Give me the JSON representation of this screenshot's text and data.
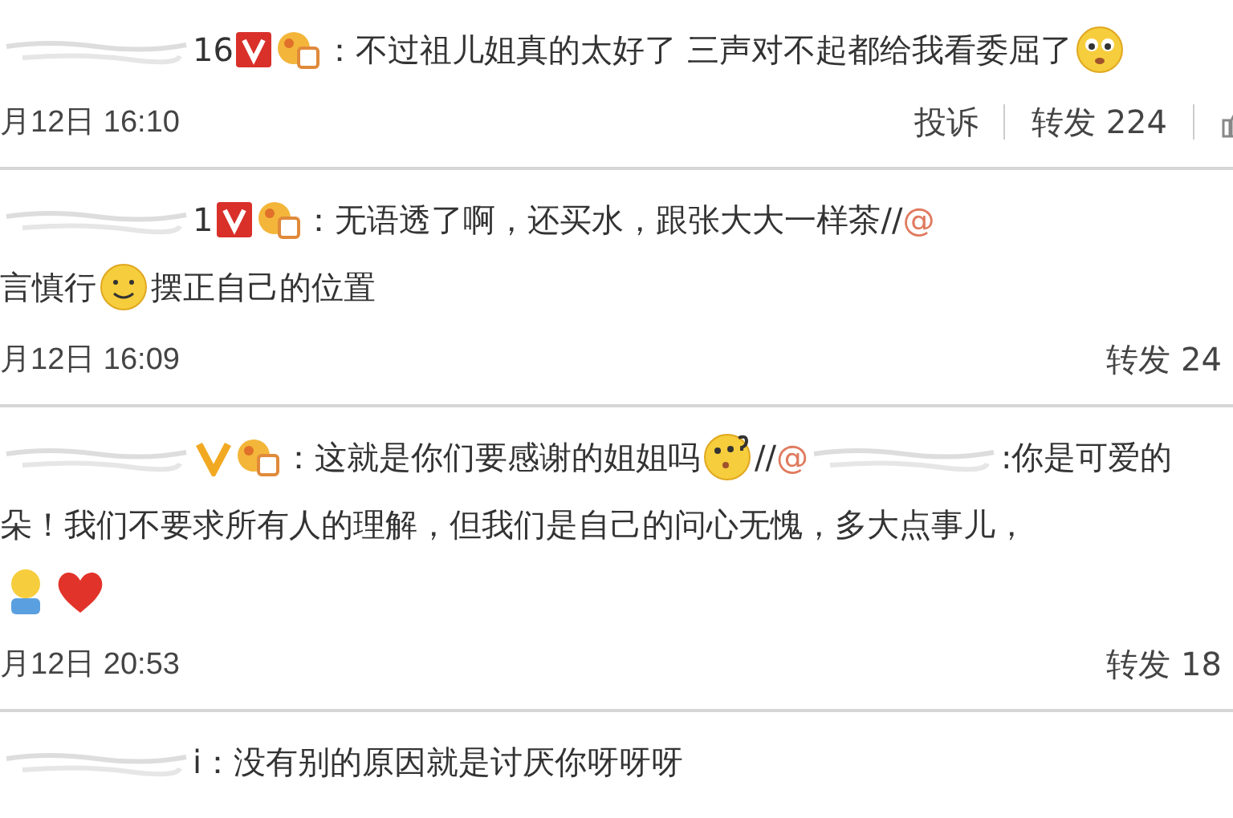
{
  "comments": [
    {
      "header": [
        {
          "kind": "redacted"
        },
        {
          "kind": "text",
          "text": "16"
        },
        {
          "kind": "vip"
        },
        {
          "kind": "member"
        },
        {
          "kind": "text",
          "text": "：不过祖儿姐真的太好了 三声对不起都给我看委屈了"
        },
        {
          "kind": "cry"
        }
      ],
      "date": "月12日 16:10",
      "actions": [
        {
          "kind": "link",
          "label": "投诉"
        },
        {
          "kind": "link",
          "label": "转发 224"
        },
        {
          "kind": "like"
        }
      ]
    },
    {
      "header": [
        {
          "kind": "redacted"
        },
        {
          "kind": "text",
          "text": "1"
        },
        {
          "kind": "vip"
        },
        {
          "kind": "member"
        },
        {
          "kind": "text",
          "text": "：无语透了啊，还买水，跟张大大一样茶//"
        },
        {
          "kind": "mention",
          "text": "@"
        }
      ],
      "lines": [
        [
          {
            "kind": "text",
            "text": "言慎行"
          },
          {
            "kind": "smile"
          },
          {
            "kind": "text",
            "text": "摆正自己的位置"
          }
        ]
      ],
      "date": "月12日 16:09",
      "actions": [
        {
          "kind": "link",
          "label": "转发 24"
        }
      ]
    },
    {
      "header": [
        {
          "kind": "redacted"
        },
        {
          "kind": "verified"
        },
        {
          "kind": "member"
        },
        {
          "kind": "text",
          "text": "：这就是你们要感谢的姐姐吗"
        },
        {
          "kind": "puzzled"
        },
        {
          "kind": "text",
          "text": "//"
        },
        {
          "kind": "mention",
          "text": "@"
        },
        {
          "kind": "redacted"
        },
        {
          "kind": "text",
          "text": ":你是可爱的"
        }
      ],
      "lines": [
        [
          {
            "kind": "text",
            "text": "朵！我们不要求所有人的理解，但我们是自己的问心无愧，多大点事儿，"
          }
        ],
        [
          {
            "kind": "figure"
          },
          {
            "kind": "heart"
          }
        ]
      ],
      "date": "月12日 20:53",
      "actions": [
        {
          "kind": "link",
          "label": "转发 18"
        }
      ]
    },
    {
      "header": [
        {
          "kind": "redacted"
        },
        {
          "kind": "text",
          "text": "i：没有别的原因就是讨厌你呀呀呀"
        }
      ]
    }
  ]
}
